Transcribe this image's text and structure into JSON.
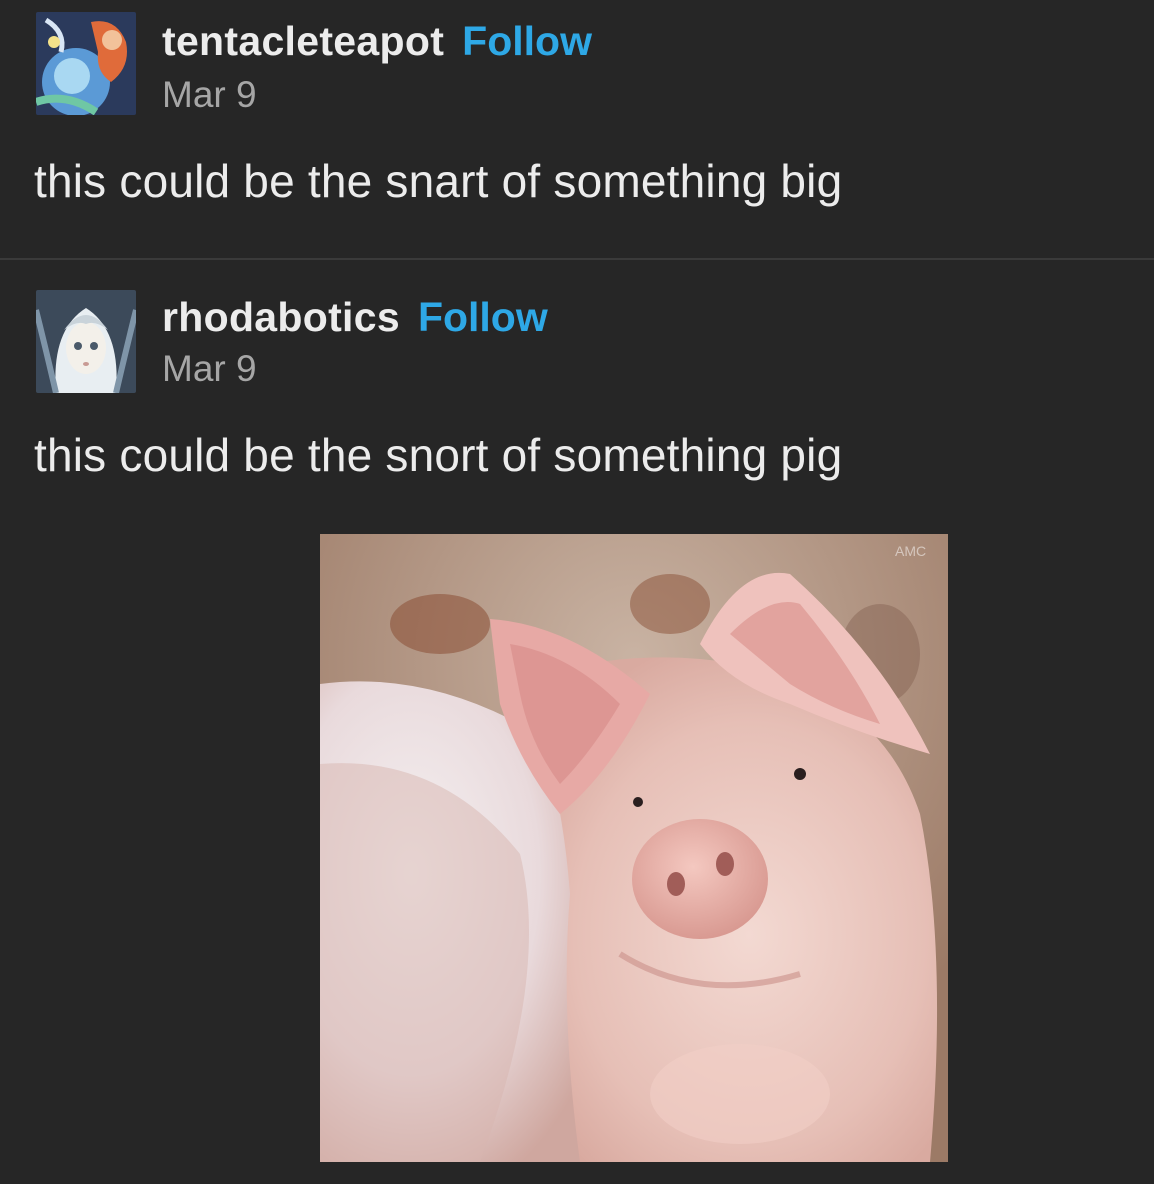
{
  "posts": [
    {
      "username": "tentacleteapot",
      "follow_label": "Follow",
      "date": "Mar 9",
      "text": "this could be the snart of something big",
      "avatar": "anime-character-avatar"
    },
    {
      "username": "rhodabotics",
      "follow_label": "Follow",
      "date": "Mar 9",
      "text": "this could be the snort of something pig",
      "avatar": "anime-girl-avatar",
      "image": "pig-photo"
    }
  ],
  "colors": {
    "background": "#262626",
    "follow": "#2ea8e6",
    "username": "#ececec",
    "date": "#a6a6a6"
  }
}
